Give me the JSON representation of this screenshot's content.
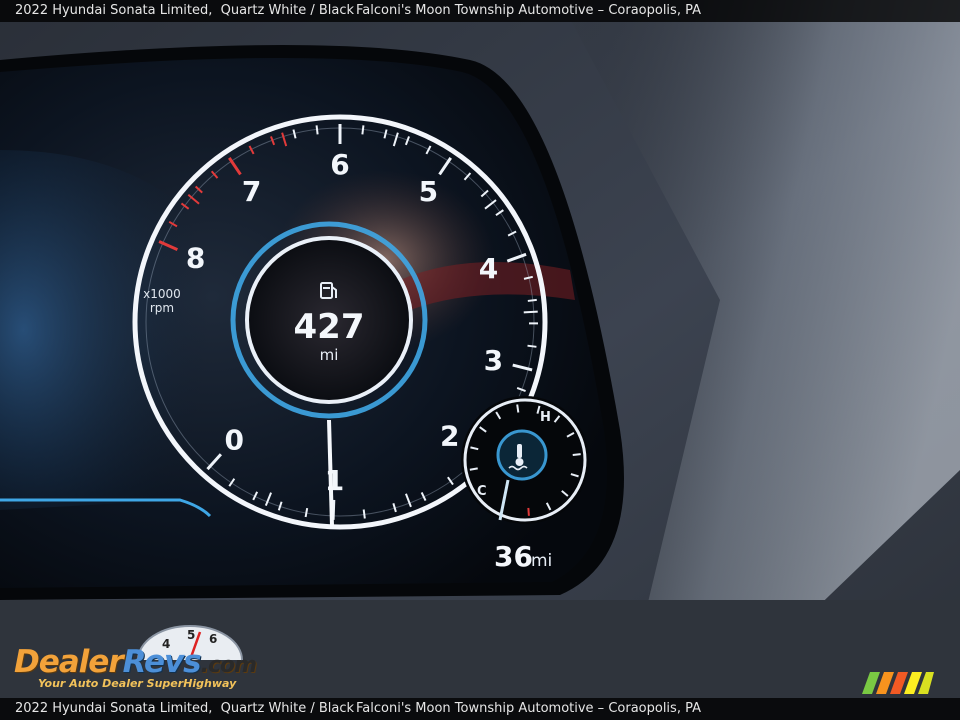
{
  "caption": {
    "vehicle": "2022 Hyundai Sonata Limited,",
    "colors": "Quartz White / Black",
    "dealer": "Falconi's Moon Township Automotive – Coraopolis, PA"
  },
  "cluster": {
    "tach_numbers": [
      "0",
      "1",
      "2",
      "3",
      "4",
      "5",
      "6",
      "7",
      "8"
    ],
    "tach_unit_line1": "x1000",
    "tach_unit_line2": "rpm",
    "range_value": "427",
    "range_unit": "mi",
    "trip_value": "36",
    "trip_unit": "mi",
    "temp_hot": "H",
    "temp_cold": "C"
  },
  "watermark": {
    "brand_a": "Dealer",
    "brand_b": "Revs",
    "brand_c": ".com",
    "tagline": "Your Auto Dealer SuperHighway",
    "dial_digits": [
      "4",
      "5",
      "6"
    ]
  },
  "colors": {
    "ring": "#f3f6fb",
    "accent_blue": "#3fa7e6",
    "redline": "#e23a3a",
    "logo_orange": "#f2a23a",
    "logo_blue": "#4c8fd8"
  }
}
